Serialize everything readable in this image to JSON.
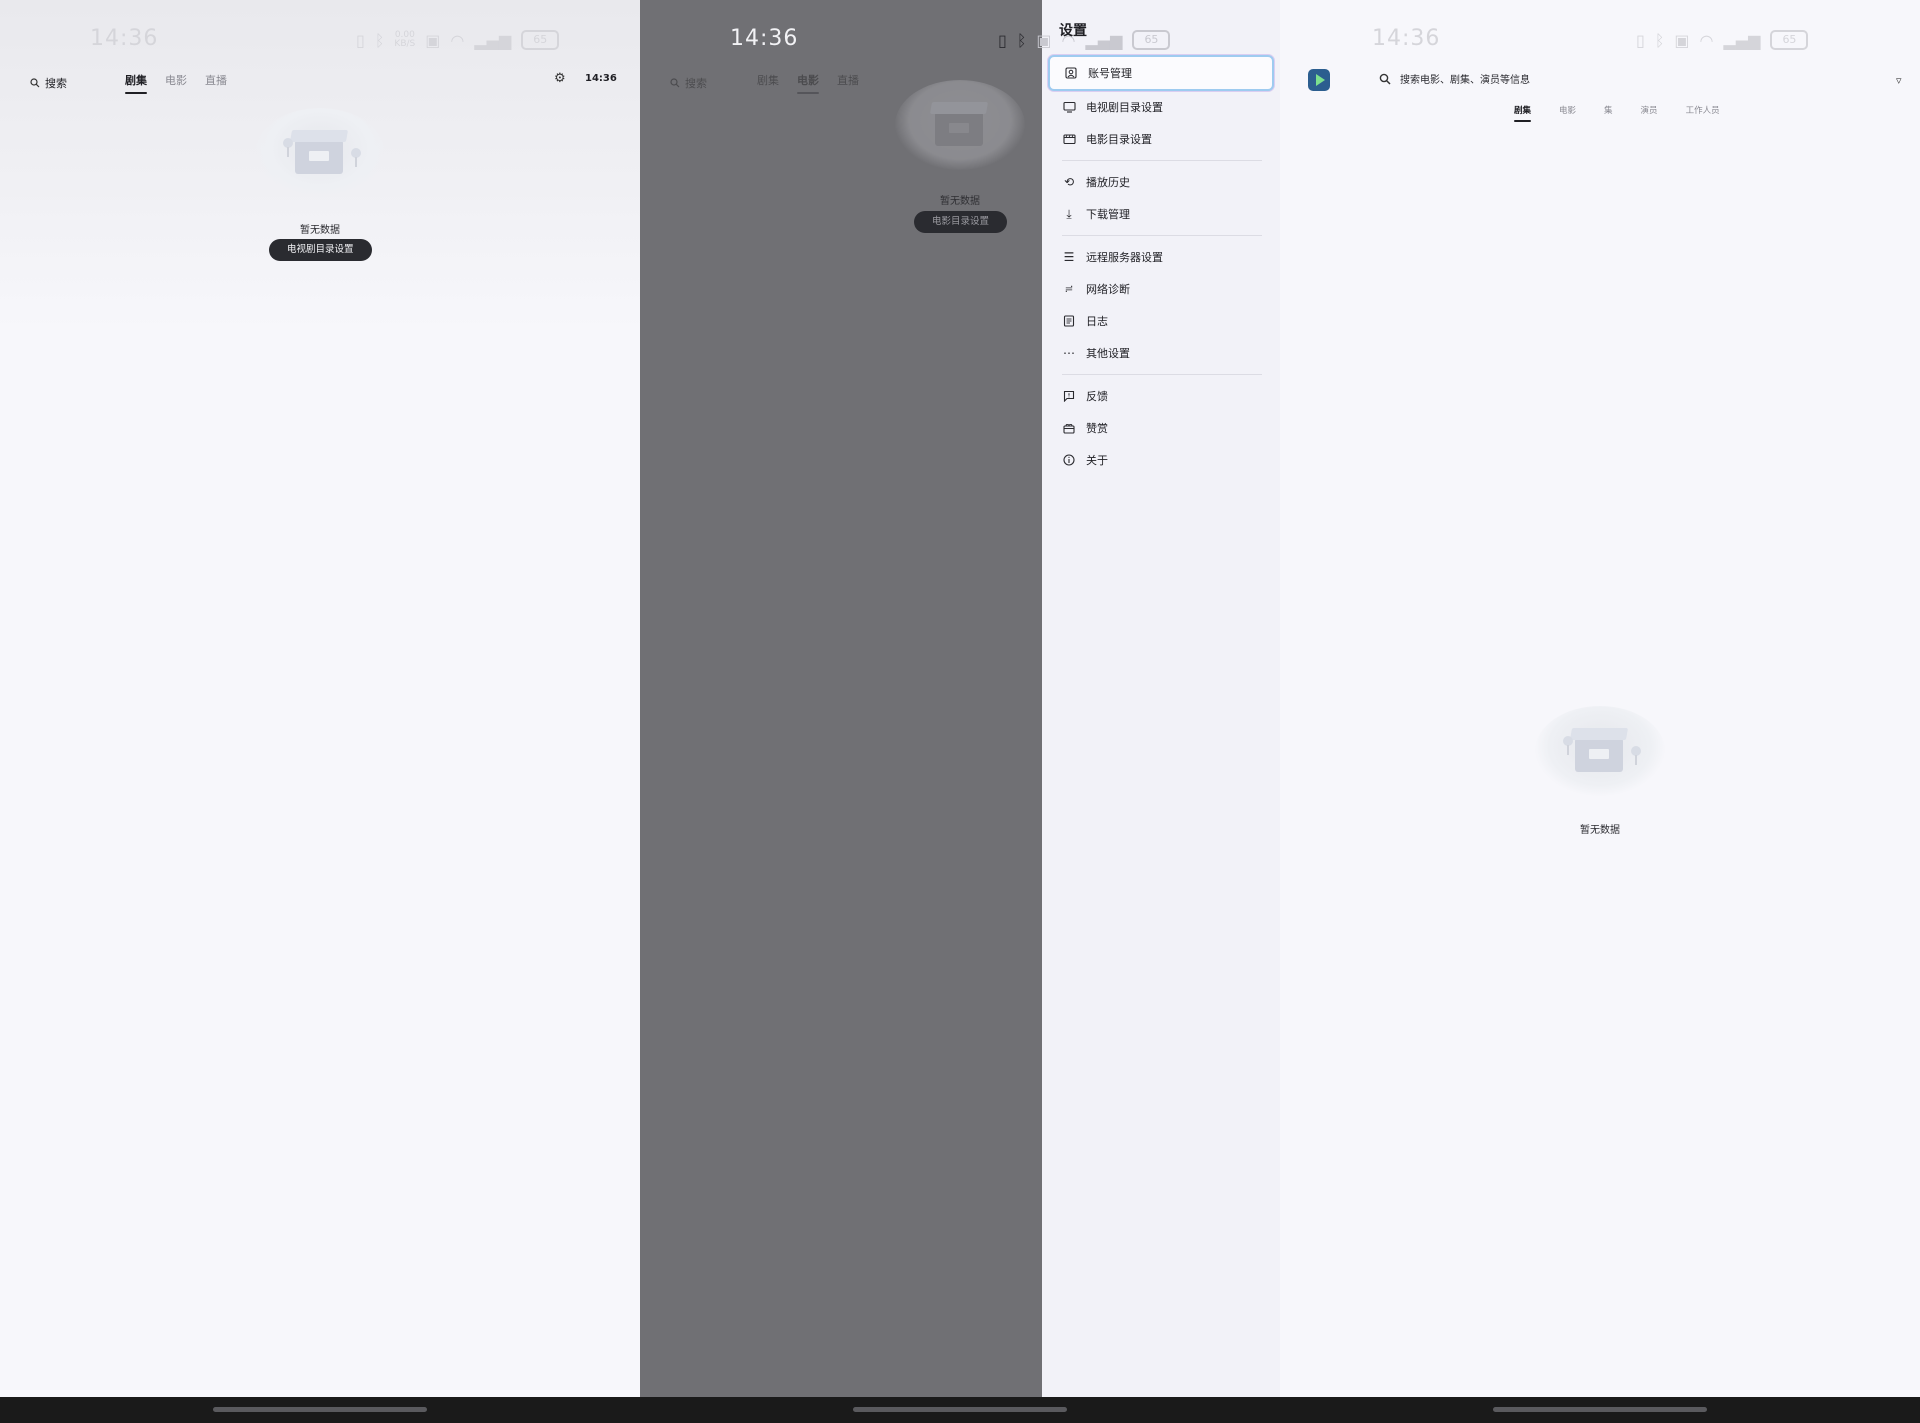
{
  "status": {
    "time": "14:36",
    "net_speed": "0.00",
    "net_unit": "KB/S",
    "battery": "65"
  },
  "panel1": {
    "search_label": "搜索",
    "tabs": [
      "剧集",
      "电影",
      "直播"
    ],
    "clock": "14:36",
    "empty_text": "暂无数据",
    "empty_button": "电视剧目录设置"
  },
  "panel2": {
    "search_label": "搜索",
    "tabs": [
      "剧集",
      "电影",
      "直播"
    ],
    "empty_text": "暂无数据",
    "empty_button": "电影目录设置",
    "drawer": {
      "title": "设置",
      "items": [
        {
          "label": "账号管理",
          "icon": "account-box-icon"
        },
        {
          "label": "电视剧目录设置",
          "icon": "tv-icon"
        },
        {
          "label": "电影目录设置",
          "icon": "movie-clapper-icon"
        },
        {
          "label": "播放历史",
          "icon": "history-icon"
        },
        {
          "label": "下载管理",
          "icon": "download-icon"
        },
        {
          "label": "远程服务器设置",
          "icon": "server-list-icon"
        },
        {
          "label": "网络诊断",
          "icon": "network-check-icon"
        },
        {
          "label": "日志",
          "icon": "log-document-icon"
        },
        {
          "label": "其他设置",
          "icon": "more-horizontal-icon"
        },
        {
          "label": "反馈",
          "icon": "feedback-icon"
        },
        {
          "label": "赞赏",
          "icon": "gift-icon"
        },
        {
          "label": "关于",
          "icon": "info-icon"
        }
      ]
    }
  },
  "panel3": {
    "search_placeholder": "搜索电影、剧集、演员等信息",
    "tabs": [
      "剧集",
      "电影",
      "集",
      "演员",
      "工作人员"
    ],
    "empty_text": "暂无数据"
  }
}
